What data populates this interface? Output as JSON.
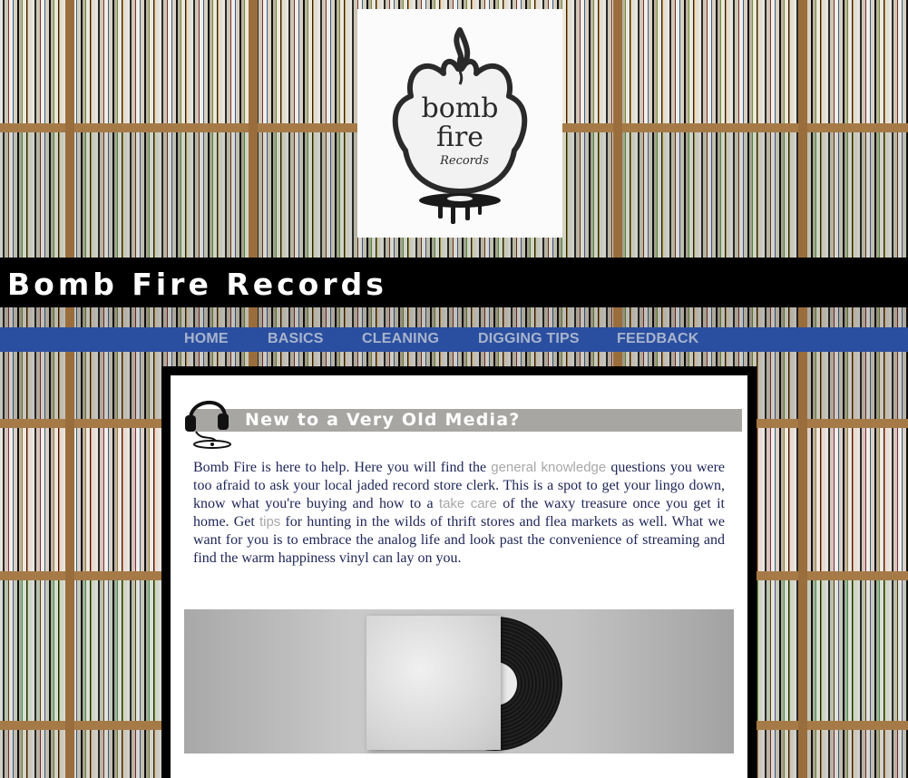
{
  "site": {
    "title": "Bomb Fire Records",
    "logo_alt": "bomb fire Records logo",
    "logo_lines": [
      "bomb",
      "fire",
      "Records"
    ]
  },
  "nav": {
    "items": [
      {
        "label": "HOME"
      },
      {
        "label": "BASICS"
      },
      {
        "label": "CLEANING"
      },
      {
        "label": "DIGGING TIPS"
      },
      {
        "label": "FEEDBACK"
      }
    ]
  },
  "main": {
    "heading": "New to a Very Old Media?",
    "intro": {
      "p1": "Bomb Fire is here to help. Here you will find the ",
      "link1": "general knowledge",
      "p2": " questions you were too afraid to ask your local jaded record store clerk. This is a spot to get your lingo down, know what you're buying and how to a ",
      "link2": "take care",
      "p3": " of the waxy treasure once you get it home. Get ",
      "link3": "tips",
      "p4": " for hunting in the wilds of thrift stores and flea markets as well. What we want for you is to embrace the analog life and look past the convenience of streaming and find the warm happiness vinyl can lay on you."
    }
  },
  "colors": {
    "nav_bg": "#2b4fa0",
    "nav_text": "#a8b4cc",
    "heading_bar": "#a7a6a2",
    "body_text": "#1d2456",
    "link_text": "#a8a8a8"
  },
  "icons": {
    "logo": "flame-record-logo",
    "heading": "headphones-turntable-icon"
  }
}
